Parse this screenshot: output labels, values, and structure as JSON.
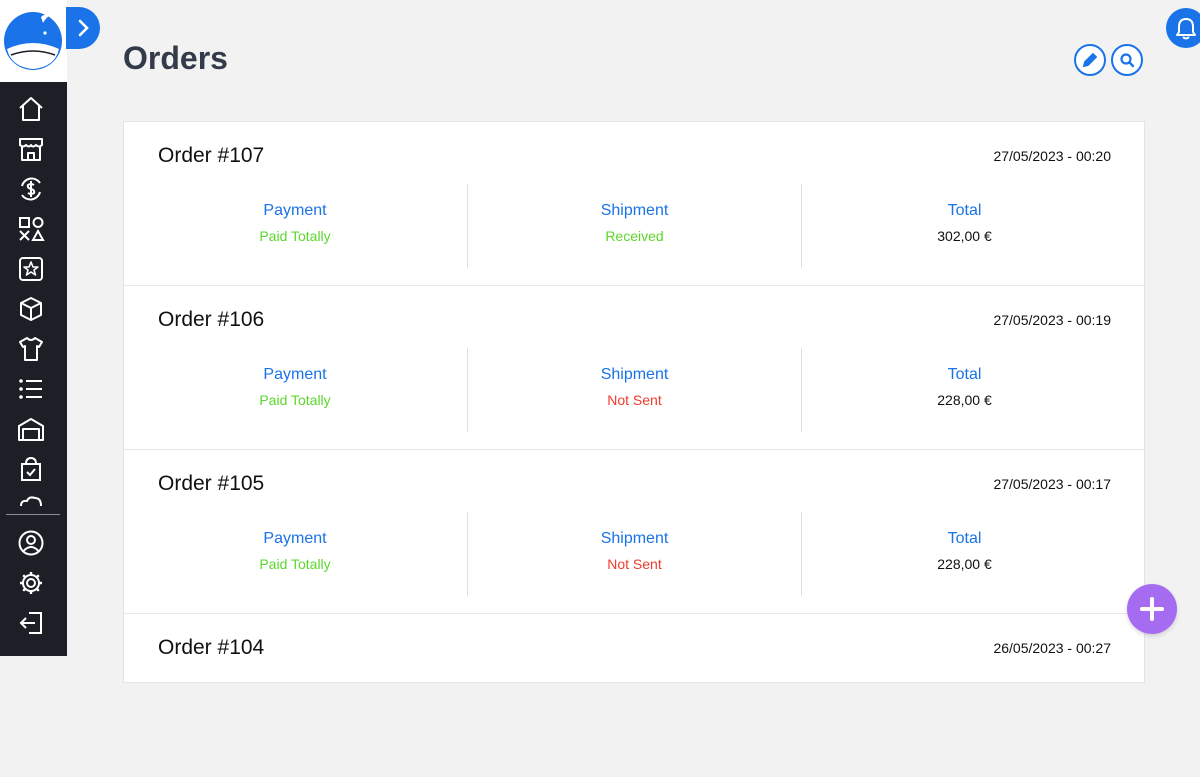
{
  "header": {
    "title": "Orders",
    "edit_icon": "pencil-icon",
    "search_icon": "search-icon",
    "bell_icon": "bell-icon"
  },
  "sidebar": {
    "logo": "whale-logo",
    "items": [
      {
        "icon": "home-icon"
      },
      {
        "icon": "store-icon"
      },
      {
        "icon": "money-sync-icon"
      },
      {
        "icon": "shapes-icon"
      },
      {
        "icon": "star-square-icon"
      },
      {
        "icon": "box-icon"
      },
      {
        "icon": "shirt-icon"
      },
      {
        "icon": "list-icon"
      },
      {
        "icon": "warehouse-icon"
      },
      {
        "icon": "checkbag-icon"
      },
      {
        "icon": "cloud-icon"
      },
      {
        "icon": "user-circle-icon"
      },
      {
        "icon": "gear-icon"
      },
      {
        "icon": "logout-icon"
      }
    ]
  },
  "labels": {
    "payment": "Payment",
    "shipment": "Shipment",
    "total": "Total"
  },
  "orders": [
    {
      "title": "Order #107",
      "date": "27/05/2023 - 00:20",
      "payment_status": "Paid Totally",
      "shipment_status": "Received",
      "total": "302,00 €"
    },
    {
      "title": "Order #106",
      "date": "27/05/2023 - 00:19",
      "payment_status": "Paid Totally",
      "shipment_status": "Not Sent",
      "total": "228,00 €"
    },
    {
      "title": "Order #105",
      "date": "27/05/2023 - 00:17",
      "payment_status": "Paid Totally",
      "shipment_status": "Not Sent",
      "total": "228,00 €"
    },
    {
      "title": "Order #104",
      "date": "26/05/2023 - 00:27"
    }
  ],
  "colors": {
    "accent": "#1a73e8",
    "sidebar_bg": "#1c1f26",
    "status_green": "#5bd72b",
    "status_red": "#ef3b2d",
    "fab": "#a56cf2"
  },
  "fab": {
    "icon": "plus-icon"
  }
}
